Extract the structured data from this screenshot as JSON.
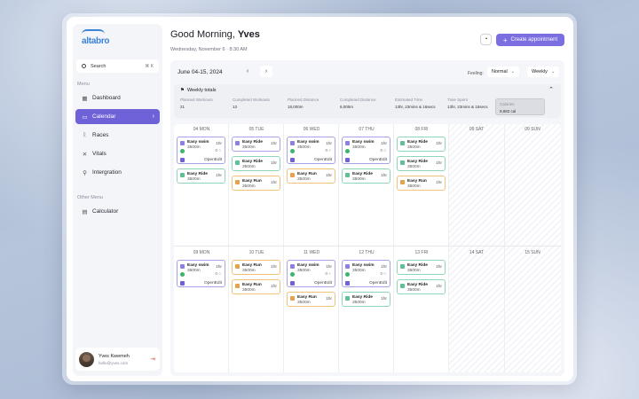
{
  "logo": "altabro",
  "search": {
    "placeholder": "Search",
    "shortcut": "⌘ K"
  },
  "menu_label": "Menu",
  "menu": [
    {
      "label": "Dashboard",
      "icon": "grid-icon"
    },
    {
      "label": "Calendar",
      "icon": "calendar-icon"
    },
    {
      "label": "Races",
      "icon": "runner-icon"
    },
    {
      "label": "Vitals",
      "icon": "heartbeat-icon"
    },
    {
      "label": "Intergration",
      "icon": "link-icon"
    }
  ],
  "other_menu_label": "Other Menu",
  "other_menu": [
    {
      "label": "Calculator",
      "icon": "calculator-icon"
    }
  ],
  "user": {
    "name": "Yves Kwemeh",
    "email": "hello@yves.com"
  },
  "greeting": {
    "prefix": "Good Morning, ",
    "name": "Yves"
  },
  "date_line": "Wednesday, November 6  ·  8:30 AM",
  "create_button": "Create appointment",
  "calendar": {
    "range": "June 04-15, 2024",
    "feeling_label": "Feeling:",
    "feeling_value": "Normal",
    "view_value": "Weekly"
  },
  "weekly_totals": {
    "title": "Weekly totals",
    "stats": [
      {
        "label": "Planned Workouts",
        "value": "21"
      },
      {
        "label": "Completed Workouts",
        "value": "13"
      },
      {
        "label": "Planned Distance",
        "value": "18,000m"
      },
      {
        "label": "Completed Distance",
        "value": "8,000m"
      },
      {
        "label": "Estimated Time",
        "value": "13hr, 23mins & 16secs"
      },
      {
        "label": "Time Spent",
        "value": "13hr, 23mins & 16secs"
      },
      {
        "label": "Calories",
        "value": "9,882 cal"
      }
    ]
  },
  "week1_days": [
    "04 MON",
    "05 TUE",
    "06 WED",
    "07 THU",
    "08 FRI",
    "09 SAT",
    "09 SUN"
  ],
  "week2_days": [
    "09 MON",
    "10 TUE",
    "11 WED",
    "12 THU",
    "13 FRI",
    "14 SAT",
    "15 SUN"
  ],
  "card_labels": {
    "open": "Open",
    "edit": "Edit",
    "dur": "1hr",
    "mini": "0  ○"
  },
  "colors": {
    "accent": "#6f62d8",
    "swim": "#8b80e0",
    "ride": "#5fbf95",
    "run": "#e6a24a"
  }
}
